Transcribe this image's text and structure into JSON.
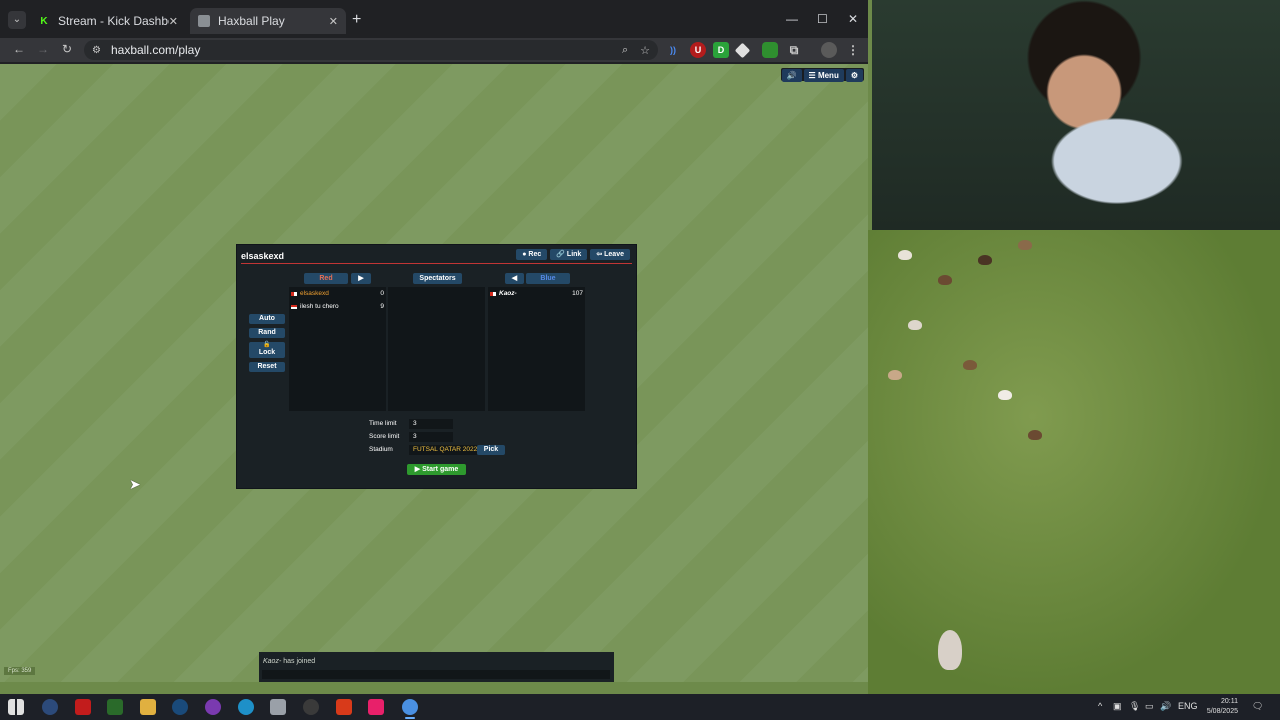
{
  "browser": {
    "tabs": [
      {
        "title": "Stream - Kick Dashboard",
        "favicon": "kick-logo"
      },
      {
        "title": "Haxball Play",
        "favicon": "haxball-logo"
      }
    ],
    "url": "haxball.com/play"
  },
  "game_menu": {
    "menu_label": "☰ Menu"
  },
  "room": {
    "title": "elsaskexd",
    "buttons": {
      "rec": "● Rec",
      "link": "🔗 Link",
      "leave": "⇦ Leave"
    },
    "teams": {
      "red_label": "Red",
      "spectators_label": "Spectators",
      "blue_label": "Blue",
      "red_arrow": "▶",
      "blue_arrow": "◀"
    },
    "red_players": [
      {
        "name": "elsaskexd",
        "ping": "0",
        "name_color": "#f0a030"
      },
      {
        "name": "ilesh tu chero",
        "ping": "9",
        "name_color": "#ffffff"
      }
    ],
    "spectators": [],
    "blue_players": [
      {
        "name": "Kaoz-",
        "ping": "107",
        "name_color": "#ffffff"
      }
    ],
    "side_buttons": {
      "auto": "Auto",
      "rand": "Rand",
      "lock": "Lock",
      "reset": "Reset"
    },
    "settings": {
      "time_limit_label": "Time limit",
      "time_limit": "3",
      "score_limit_label": "Score limit",
      "score_limit": "3",
      "stadium_label": "Stadium",
      "stadium": "FUTSAL QATAR 2022 ...",
      "pick_label": "Pick"
    },
    "start_label": "▶ Start game"
  },
  "chat": {
    "message_name": "Kaoz-",
    "message_text": " has joined"
  },
  "fps": "Fps: 359",
  "taskbar": {
    "language": "ENG",
    "time": "20:11",
    "date": "5/08/2025"
  },
  "colors": {
    "red_team": "#e56e56",
    "blue_team": "#5689e5",
    "button": "#244967",
    "start_button": "#2e9a2e",
    "pitch": "#7e9a61"
  }
}
